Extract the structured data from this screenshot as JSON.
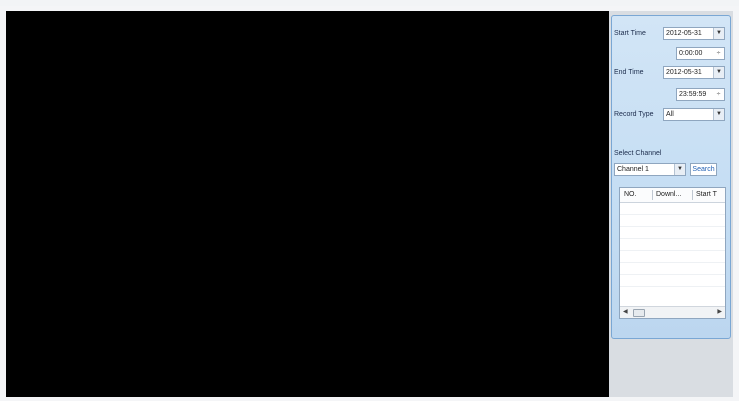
{
  "search_panel": {
    "start_time_label": "Start Time",
    "start_date": "2012-05-31",
    "start_clock": "0:00:00",
    "end_time_label": "End Time",
    "end_date": "2012-05-31",
    "end_clock": "23:59:59",
    "record_type_label": "Record Type",
    "record_type_value": "All",
    "select_channel_label": "Select Channel",
    "channel_value": "Channel 1",
    "search_label": "Search"
  },
  "results_table": {
    "columns": [
      "NO.",
      "Downl...",
      "Start T"
    ],
    "rows": []
  },
  "icons": {
    "dropdown": "chevron-down-icon",
    "spinner": "spin-updown-icon",
    "scroll_left": "arrow-left-icon",
    "scroll_right": "arrow-right-icon"
  }
}
